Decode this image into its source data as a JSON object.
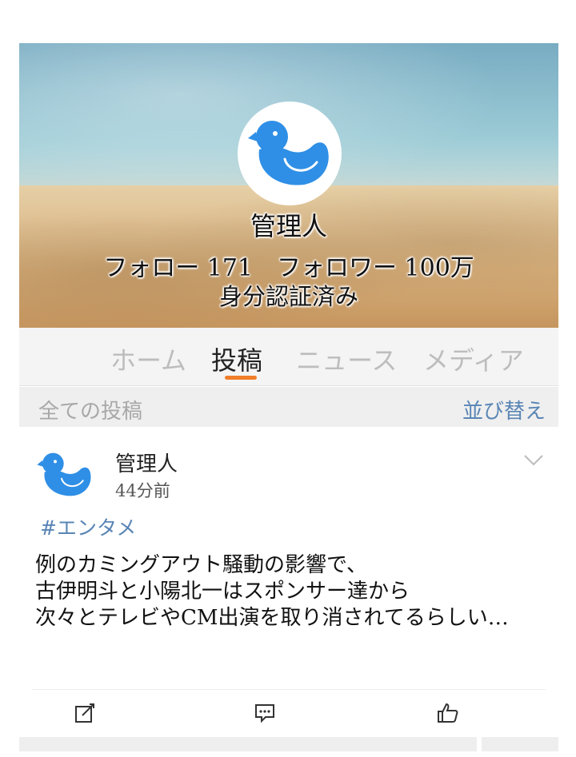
{
  "profile": {
    "name": "管理人",
    "follow_line": "フォロー 171　フォロワー 100万",
    "verified": "身分認証済み"
  },
  "tabs": [
    {
      "label": "ホーム"
    },
    {
      "label": "投稿"
    },
    {
      "label": "ニュース"
    },
    {
      "label": "メディア"
    }
  ],
  "filter": {
    "all_posts": "全ての投稿",
    "sort": "並び替え"
  },
  "post": {
    "author": "管理人",
    "time": "44分前",
    "tag": "#エンタメ",
    "lines": [
      "例のカミングアウト騒動の影響で、",
      "古伊明斗と小陽北一はスポンサー達から",
      "次々とテレビやCM出演を取り消されてるらしい…"
    ]
  },
  "colors": {
    "accent": "#f07e2a",
    "link": "#5a86b5",
    "bird": "#2f8fe6"
  }
}
